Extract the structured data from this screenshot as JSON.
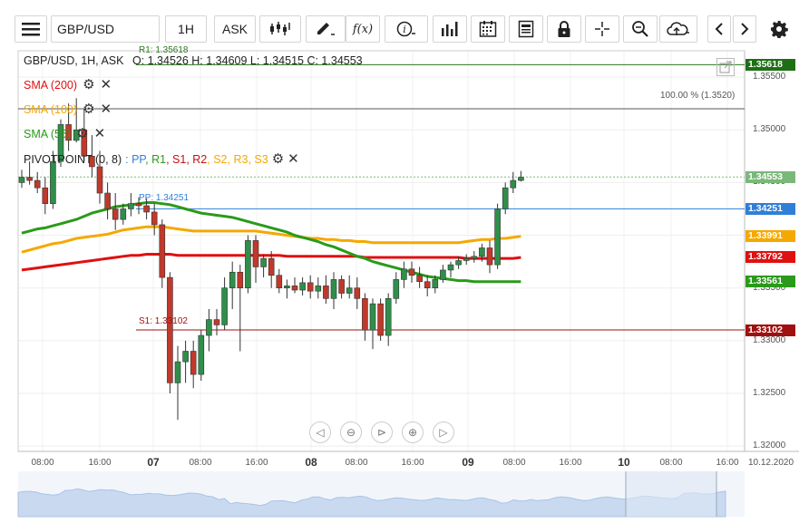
{
  "toolbar": {
    "menu_icon": "hamburger-icon",
    "symbol_value": "GBP/USD",
    "timeframe": "1H",
    "price_type": "ASK",
    "fx_label": "f(x)",
    "info_label": "i"
  },
  "legend": {
    "header": "GBP/USD, 1H, ASK",
    "ohlc": "O: 1.34526 H: 1.34609 L: 1.34515 C: 1.34553",
    "indicators": [
      {
        "label": "SMA (200)",
        "color": "#e01010"
      },
      {
        "label": "SMA (100)",
        "color": "#f5a800"
      },
      {
        "label": "SMA (55)",
        "color": "#2a9a1a"
      }
    ],
    "pivot_label": "PIVOTPOINT (0, 8)",
    "pivot_parts": [
      {
        "text": ": PP",
        "color": "#2f7fd8"
      },
      {
        "text": ", R1",
        "color": "#2a9a1a"
      },
      {
        "text": ", S1",
        "color": "#c41010"
      },
      {
        "text": ", R2",
        "color": "#c41010"
      },
      {
        "text": ", S2",
        "color": "#f5a800"
      },
      {
        "text": ", R3",
        "color": "#f5a800"
      },
      {
        "text": ", S3",
        "color": "#f5a800"
      }
    ]
  },
  "line_labels": {
    "r1": "R1: 1.35618",
    "s1": "S1: 1.33102",
    "pp": "PP: 1.34251",
    "fib": "100.00 % (1.3520)"
  },
  "y_axis": {
    "ticks": [
      "1.35500",
      "1.35000",
      "1.34500",
      "1.34000",
      "1.33500",
      "1.33000",
      "1.32500",
      "1.32000"
    ]
  },
  "price_tags": [
    {
      "value": "1.35618",
      "color": "#1e6e14"
    },
    {
      "value": "1.34553",
      "color": "#7ab87a"
    },
    {
      "value": "1.34251",
      "color": "#2f7fd8"
    },
    {
      "value": "1.33991",
      "color": "#f5a800"
    },
    {
      "value": "1.33792",
      "color": "#e01010"
    },
    {
      "value": "1.33561",
      "color": "#2a9a1a"
    },
    {
      "value": "1.33102",
      "color": "#a01010"
    }
  ],
  "x_axis": {
    "labels": [
      {
        "text": "08:00",
        "bold": false
      },
      {
        "text": "16:00",
        "bold": false
      },
      {
        "text": "07",
        "bold": true
      },
      {
        "text": "08:00",
        "bold": false
      },
      {
        "text": "16:00",
        "bold": false
      },
      {
        "text": "08",
        "bold": true
      },
      {
        "text": "08:00",
        "bold": false
      },
      {
        "text": "16:00",
        "bold": false
      },
      {
        "text": "09",
        "bold": true
      },
      {
        "text": "08:00",
        "bold": false
      },
      {
        "text": "16:00",
        "bold": false
      },
      {
        "text": "10",
        "bold": true
      },
      {
        "text": "08:00",
        "bold": false
      },
      {
        "text": "16:00",
        "bold": false
      }
    ],
    "end_date": "10.12.2020"
  },
  "chart_data": {
    "type": "candlestick",
    "symbol": "GBP/USD",
    "timeframe": "1H",
    "ylim": [
      1.3195,
      1.3575
    ],
    "ohlc": [
      [
        1.345,
        1.3462,
        1.3445,
        1.3455
      ],
      [
        1.3455,
        1.347,
        1.3448,
        1.3452
      ],
      [
        1.3452,
        1.346,
        1.344,
        1.3445
      ],
      [
        1.3445,
        1.3455,
        1.342,
        1.343
      ],
      [
        1.343,
        1.348,
        1.3425,
        1.347
      ],
      [
        1.347,
        1.351,
        1.3465,
        1.3505
      ],
      [
        1.3505,
        1.3525,
        1.348,
        1.349
      ],
      [
        1.349,
        1.353,
        1.3488,
        1.35
      ],
      [
        1.35,
        1.352,
        1.347,
        1.3475
      ],
      [
        1.3475,
        1.3495,
        1.3455,
        1.3465
      ],
      [
        1.3465,
        1.348,
        1.343,
        1.344
      ],
      [
        1.344,
        1.345,
        1.3415,
        1.3425
      ],
      [
        1.3425,
        1.344,
        1.3405,
        1.3415
      ],
      [
        1.3415,
        1.343,
        1.341,
        1.3425
      ],
      [
        1.3425,
        1.344,
        1.3418,
        1.343
      ],
      [
        1.343,
        1.3436,
        1.342,
        1.3428
      ],
      [
        1.3428,
        1.3435,
        1.3415,
        1.3422
      ],
      [
        1.3422,
        1.343,
        1.34,
        1.341
      ],
      [
        1.341,
        1.3415,
        1.335,
        1.336
      ],
      [
        1.336,
        1.3365,
        1.325,
        1.326
      ],
      [
        1.326,
        1.3295,
        1.3225,
        1.328
      ],
      [
        1.328,
        1.33,
        1.326,
        1.329
      ],
      [
        1.329,
        1.33,
        1.3255,
        1.3268
      ],
      [
        1.3268,
        1.331,
        1.3262,
        1.3305
      ],
      [
        1.3305,
        1.333,
        1.329,
        1.332
      ],
      [
        1.332,
        1.333,
        1.3305,
        1.3315
      ],
      [
        1.3315,
        1.336,
        1.331,
        1.335
      ],
      [
        1.335,
        1.3375,
        1.333,
        1.3365
      ],
      [
        1.3365,
        1.3372,
        1.329,
        1.335
      ],
      [
        1.335,
        1.34,
        1.3345,
        1.3395
      ],
      [
        1.3395,
        1.34,
        1.3355,
        1.337
      ],
      [
        1.337,
        1.3382,
        1.336,
        1.3378
      ],
      [
        1.3378,
        1.3385,
        1.335,
        1.3362
      ],
      [
        1.3362,
        1.3368,
        1.3345,
        1.335
      ],
      [
        1.335,
        1.3358,
        1.334,
        1.3352
      ],
      [
        1.3352,
        1.336,
        1.3345,
        1.3348
      ],
      [
        1.3348,
        1.336,
        1.3343,
        1.3355
      ],
      [
        1.3355,
        1.3362,
        1.334,
        1.3347
      ],
      [
        1.3347,
        1.336,
        1.334,
        1.3352
      ],
      [
        1.3352,
        1.3362,
        1.3335,
        1.334
      ],
      [
        1.334,
        1.3365,
        1.333,
        1.3358
      ],
      [
        1.3358,
        1.3362,
        1.334,
        1.3345
      ],
      [
        1.3345,
        1.3362,
        1.334,
        1.335
      ],
      [
        1.335,
        1.336,
        1.333,
        1.334
      ],
      [
        1.334,
        1.3345,
        1.33,
        1.331
      ],
      [
        1.331,
        1.334,
        1.3292,
        1.3335
      ],
      [
        1.3335,
        1.334,
        1.33,
        1.3305
      ],
      [
        1.3305,
        1.3345,
        1.3295,
        1.334
      ],
      [
        1.334,
        1.3365,
        1.3335,
        1.3358
      ],
      [
        1.3358,
        1.3375,
        1.335,
        1.3368
      ],
      [
        1.3368,
        1.3375,
        1.3355,
        1.3362
      ],
      [
        1.3362,
        1.337,
        1.335,
        1.3356
      ],
      [
        1.3356,
        1.3362,
        1.3342,
        1.335
      ],
      [
        1.335,
        1.3362,
        1.3345,
        1.3358
      ],
      [
        1.3358,
        1.3372,
        1.3355,
        1.3367
      ],
      [
        1.3367,
        1.3375,
        1.336,
        1.3372
      ],
      [
        1.3372,
        1.338,
        1.3368,
        1.3376
      ],
      [
        1.3376,
        1.3382,
        1.3372,
        1.3378
      ],
      [
        1.3378,
        1.3385,
        1.3374,
        1.338
      ],
      [
        1.338,
        1.3392,
        1.3375,
        1.3388
      ],
      [
        1.3388,
        1.3395,
        1.3364,
        1.3372
      ],
      [
        1.3372,
        1.343,
        1.3368,
        1.3425
      ],
      [
        1.3425,
        1.345,
        1.342,
        1.3445
      ],
      [
        1.3445,
        1.346,
        1.344,
        1.3452
      ],
      [
        1.3452,
        1.3461,
        1.3451,
        1.3455
      ]
    ],
    "series": [
      {
        "name": "SMA (200)",
        "color": "#e01010",
        "values": [
          1.3367,
          1.3368,
          1.3369,
          1.337,
          1.3371,
          1.3372,
          1.3373,
          1.3374,
          1.3375,
          1.3376,
          1.3377,
          1.3378,
          1.3379,
          1.338,
          1.3381,
          1.3381,
          1.3382,
          1.3382,
          1.3382,
          1.3382,
          1.3381,
          1.3381,
          1.3381,
          1.3381,
          1.3381,
          1.3381,
          1.3381,
          1.3381,
          1.3381,
          1.3381,
          1.3381,
          1.3381,
          1.3381,
          1.3381,
          1.338,
          1.338,
          1.338,
          1.338,
          1.338,
          1.338,
          1.338,
          1.338,
          1.338,
          1.338,
          1.3379,
          1.3379,
          1.3379,
          1.3379,
          1.3379,
          1.3379,
          1.3379,
          1.3379,
          1.3379,
          1.3379,
          1.3379,
          1.3379,
          1.3379,
          1.3378,
          1.3378,
          1.3378,
          1.3378,
          1.3378,
          1.3378,
          1.3378,
          1.3379
        ]
      },
      {
        "name": "SMA (100)",
        "color": "#f5a800",
        "values": [
          1.3384,
          1.3386,
          1.3388,
          1.339,
          1.3392,
          1.3393,
          1.3395,
          1.3397,
          1.3398,
          1.3399,
          1.34,
          1.3401,
          1.3403,
          1.3405,
          1.3406,
          1.3407,
          1.3408,
          1.3408,
          1.3408,
          1.3407,
          1.3406,
          1.3405,
          1.3404,
          1.3404,
          1.3404,
          1.3404,
          1.3404,
          1.3404,
          1.3404,
          1.3404,
          1.3404,
          1.3403,
          1.3402,
          1.3401,
          1.34,
          1.3399,
          1.3398,
          1.3397,
          1.3397,
          1.3396,
          1.3396,
          1.3395,
          1.3395,
          1.3394,
          1.3394,
          1.3393,
          1.3393,
          1.3393,
          1.3393,
          1.3393,
          1.3393,
          1.3393,
          1.3393,
          1.3393,
          1.3393,
          1.3393,
          1.3393,
          1.3394,
          1.3395,
          1.3396,
          1.3396,
          1.3397,
          1.3397,
          1.3398,
          1.3399
        ]
      },
      {
        "name": "SMA (55)",
        "color": "#2a9a1a",
        "values": [
          1.3402,
          1.3404,
          1.3406,
          1.3407,
          1.3409,
          1.3411,
          1.3413,
          1.3415,
          1.3418,
          1.3421,
          1.3423,
          1.3425,
          1.3427,
          1.3428,
          1.3429,
          1.343,
          1.3431,
          1.3431,
          1.343,
          1.3429,
          1.3427,
          1.3425,
          1.3423,
          1.3421,
          1.342,
          1.3419,
          1.3418,
          1.3417,
          1.3415,
          1.3413,
          1.3411,
          1.3409,
          1.3407,
          1.3405,
          1.3403,
          1.34,
          1.3398,
          1.3396,
          1.3394,
          1.3391,
          1.3389,
          1.3386,
          1.3383,
          1.338,
          1.3378,
          1.3375,
          1.3373,
          1.3371,
          1.3369,
          1.3367,
          1.3365,
          1.3363,
          1.3361,
          1.336,
          1.3359,
          1.3358,
          1.3357,
          1.3357,
          1.3356,
          1.3356,
          1.3356,
          1.3356,
          1.3356,
          1.3356,
          1.3356
        ]
      }
    ],
    "levels": [
      {
        "name": "R1",
        "value": 1.35618
      },
      {
        "name": "PP",
        "value": 1.34251
      },
      {
        "name": "S1",
        "value": 1.33102
      }
    ]
  }
}
